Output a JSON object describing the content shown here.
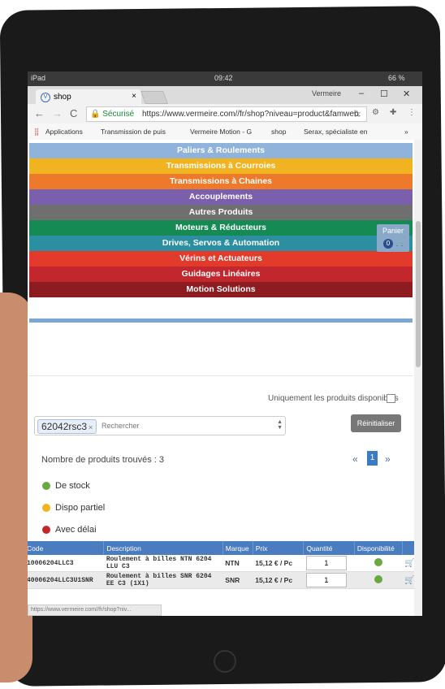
{
  "device": {
    "carrier": "iPad",
    "time": "09:42",
    "battery": "66 %"
  },
  "browser": {
    "tab_title": "shop",
    "tab_close": "×",
    "user": "Vermeire",
    "win_min": "–",
    "win_max": "☐",
    "win_close": "✕",
    "back": "←",
    "forward": "→",
    "reload": "C",
    "secure_label": "Sécurisé",
    "url": "https://www.vermeire.com//fr/shop?niveau=product&famweb...",
    "star": "☆",
    "bookmarks": [
      "Applications",
      "Transmission de puis",
      "Vermeire Motion - G",
      "shop",
      "Serax, spécialiste en"
    ],
    "more": "»"
  },
  "menu": [
    {
      "label": "Paliers & Roulements",
      "color": "#8fb3da"
    },
    {
      "label": "Transmissions à Courroies",
      "color": "#f2b321"
    },
    {
      "label": "Transmissions à Chaines",
      "color": "#ec7a2a"
    },
    {
      "label": "Accouplements",
      "color": "#7a5fad"
    },
    {
      "label": "Autres Produits",
      "color": "#6f6f6f"
    },
    {
      "label": "Moteurs & Réducteurs",
      "color": "#158a53"
    },
    {
      "label": "Drives, Servos & Automation",
      "color": "#2b8fa1"
    },
    {
      "label": "Vérins et Actuateurs",
      "color": "#e23b2c"
    },
    {
      "label": "Guidages Linéaires",
      "color": "#c1272d"
    },
    {
      "label": "Motion Solutions",
      "color": "#8c1c20"
    }
  ],
  "cart": {
    "label": "Panier",
    "count": "0"
  },
  "filters": {
    "only_available_label": "Uniquement les produits disponibles",
    "search_chip": "62042rsc3",
    "search_chip_remove": "×",
    "search_placeholder": "Rechercher",
    "reset_label": "Réinitialiser"
  },
  "results": {
    "count_label": "Nombre de produits trouvés : 3",
    "prev": "«",
    "page": "1",
    "next": "»"
  },
  "legend": [
    {
      "label": "De stock",
      "color": "#6aa840"
    },
    {
      "label": "Dispo partiel",
      "color": "#f2b321"
    },
    {
      "label": "Avec délai",
      "color": "#c1272d"
    }
  ],
  "table": {
    "headers": [
      "Code",
      "Description",
      "Marque",
      "Prix",
      "Quantité",
      "Disponibilité",
      ""
    ],
    "rows": [
      {
        "code": "10006204LLC3",
        "description": "Roulement à billes NTN 6204 LLU C3",
        "brand": "NTN",
        "price": "15,12 € / Pc",
        "qty": "1"
      },
      {
        "code": "40006204LLC3U1SNR",
        "description": "Roulement à billes SNR 6204 EE C3 (1X1)",
        "brand": "SNR",
        "price": "15,12 € / Pc",
        "qty": "1"
      }
    ]
  },
  "status_url": "https://www.vermeire.com//fr/shop?niv..."
}
